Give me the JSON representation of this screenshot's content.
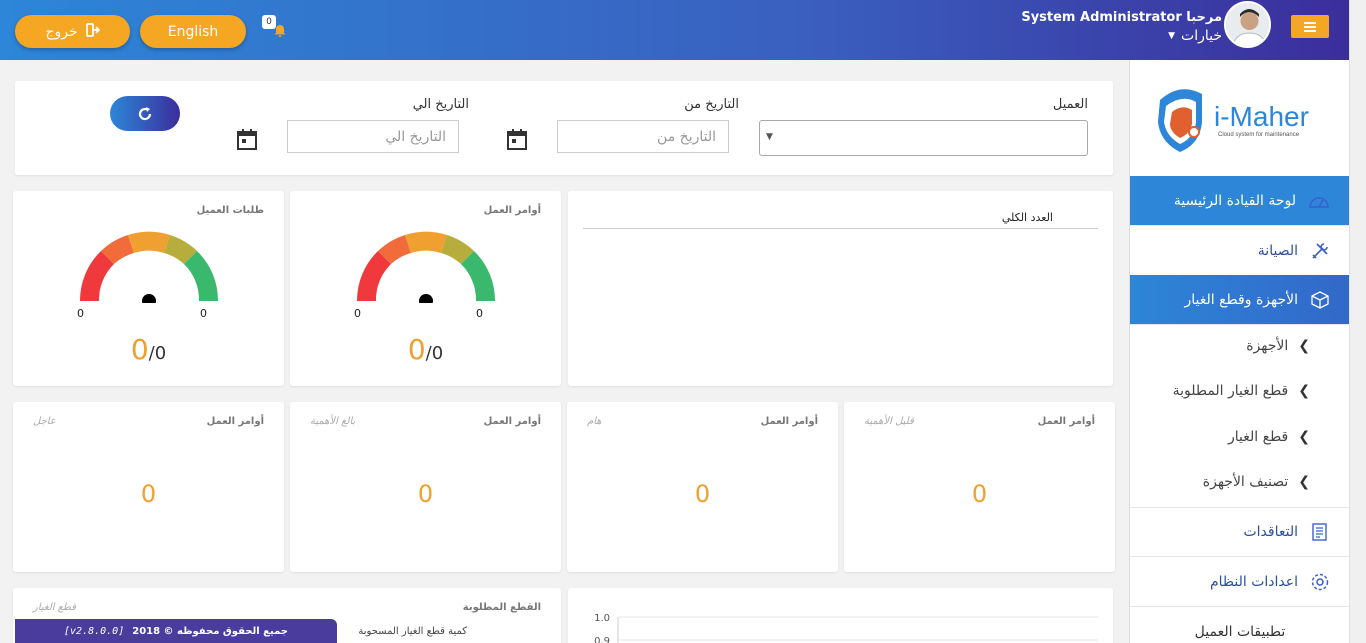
{
  "header": {
    "logout_label": "خروج",
    "language_label": "English",
    "notifications_count": "0",
    "greeting": "مرحبا System Administrator",
    "options_label": "خيارات"
  },
  "sidebar": {
    "logo_text": "i-Maher",
    "logo_tagline": "Cloud system for maintenance",
    "items": [
      {
        "label": "لوحة القيادة الرئيسية"
      },
      {
        "label": "الصيانة"
      },
      {
        "label": "الأجهزة وقطع الغيار"
      },
      {
        "label": "الأجهزة"
      },
      {
        "label": "قطع الغيار المطلوبة"
      },
      {
        "label": "قطع الغيار"
      },
      {
        "label": "تصنيف الأجهزة"
      },
      {
        "label": "التعاقدات"
      },
      {
        "label": "اعدادات النظام"
      },
      {
        "label": "تطبيقات العميل"
      }
    ]
  },
  "filters": {
    "client_label": "العميل",
    "date_from_label": "التاريخ من",
    "date_from_placeholder": "التاريخ من",
    "date_to_label": "التاريخ الي",
    "date_to_placeholder": "التاريخ الي"
  },
  "gauges": [
    {
      "title": "طلبات العميل",
      "min": "0",
      "max": "0",
      "value": "0",
      "total": "/0"
    },
    {
      "title": "أوامر العمل",
      "min": "0",
      "max": "0",
      "value": "0",
      "total": "/0"
    }
  ],
  "total_chart": {
    "label": "العدد الكلي"
  },
  "priority_cards": [
    {
      "title": "أوامر العمل",
      "sub": "عاجل",
      "value": "0"
    },
    {
      "title": "أوامر العمل",
      "sub": "بالغ الأهمية",
      "value": "0"
    },
    {
      "title": "أوامر العمل",
      "sub": "هام",
      "value": "0"
    },
    {
      "title": "أوامر العمل",
      "sub": "قليل الأهمية",
      "value": "0"
    }
  ],
  "parts_card": {
    "title": "القطع المطلوبة",
    "sub": "قطع الغيار",
    "legend": "كمية قطع الغيار المسحوبة"
  },
  "chart_data": {
    "type": "line",
    "ylim": [
      0.9,
      1.0
    ],
    "yticks": [
      "1.0",
      "0.9"
    ],
    "series": []
  },
  "footer": {
    "copyright": "جميع الحقوق محفوظه © 2018",
    "version": "[v2.8.0.0]"
  },
  "colors": {
    "accent": "#f5a623",
    "primary": "#2d86d8",
    "dark": "#3b2e9c"
  }
}
